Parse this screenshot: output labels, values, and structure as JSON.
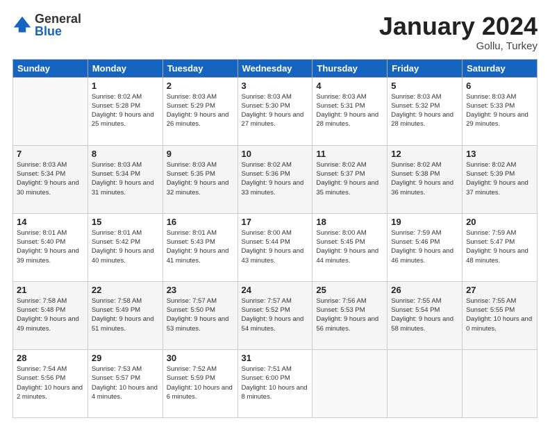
{
  "logo": {
    "general": "General",
    "blue": "Blue"
  },
  "header": {
    "title": "January 2024",
    "subtitle": "Gollu, Turkey"
  },
  "days_of_week": [
    "Sunday",
    "Monday",
    "Tuesday",
    "Wednesday",
    "Thursday",
    "Friday",
    "Saturday"
  ],
  "weeks": [
    [
      {
        "day": null
      },
      {
        "day": "1",
        "sunrise": "Sunrise: 8:02 AM",
        "sunset": "Sunset: 5:28 PM",
        "daylight": "Daylight: 9 hours and 25 minutes."
      },
      {
        "day": "2",
        "sunrise": "Sunrise: 8:03 AM",
        "sunset": "Sunset: 5:29 PM",
        "daylight": "Daylight: 9 hours and 26 minutes."
      },
      {
        "day": "3",
        "sunrise": "Sunrise: 8:03 AM",
        "sunset": "Sunset: 5:30 PM",
        "daylight": "Daylight: 9 hours and 27 minutes."
      },
      {
        "day": "4",
        "sunrise": "Sunrise: 8:03 AM",
        "sunset": "Sunset: 5:31 PM",
        "daylight": "Daylight: 9 hours and 28 minutes."
      },
      {
        "day": "5",
        "sunrise": "Sunrise: 8:03 AM",
        "sunset": "Sunset: 5:32 PM",
        "daylight": "Daylight: 9 hours and 28 minutes."
      },
      {
        "day": "6",
        "sunrise": "Sunrise: 8:03 AM",
        "sunset": "Sunset: 5:33 PM",
        "daylight": "Daylight: 9 hours and 29 minutes."
      }
    ],
    [
      {
        "day": "7",
        "sunrise": "Sunrise: 8:03 AM",
        "sunset": "Sunset: 5:34 PM",
        "daylight": "Daylight: 9 hours and 30 minutes."
      },
      {
        "day": "8",
        "sunrise": "Sunrise: 8:03 AM",
        "sunset": "Sunset: 5:34 PM",
        "daylight": "Daylight: 9 hours and 31 minutes."
      },
      {
        "day": "9",
        "sunrise": "Sunrise: 8:03 AM",
        "sunset": "Sunset: 5:35 PM",
        "daylight": "Daylight: 9 hours and 32 minutes."
      },
      {
        "day": "10",
        "sunrise": "Sunrise: 8:02 AM",
        "sunset": "Sunset: 5:36 PM",
        "daylight": "Daylight: 9 hours and 33 minutes."
      },
      {
        "day": "11",
        "sunrise": "Sunrise: 8:02 AM",
        "sunset": "Sunset: 5:37 PM",
        "daylight": "Daylight: 9 hours and 35 minutes."
      },
      {
        "day": "12",
        "sunrise": "Sunrise: 8:02 AM",
        "sunset": "Sunset: 5:38 PM",
        "daylight": "Daylight: 9 hours and 36 minutes."
      },
      {
        "day": "13",
        "sunrise": "Sunrise: 8:02 AM",
        "sunset": "Sunset: 5:39 PM",
        "daylight": "Daylight: 9 hours and 37 minutes."
      }
    ],
    [
      {
        "day": "14",
        "sunrise": "Sunrise: 8:01 AM",
        "sunset": "Sunset: 5:40 PM",
        "daylight": "Daylight: 9 hours and 39 minutes."
      },
      {
        "day": "15",
        "sunrise": "Sunrise: 8:01 AM",
        "sunset": "Sunset: 5:42 PM",
        "daylight": "Daylight: 9 hours and 40 minutes."
      },
      {
        "day": "16",
        "sunrise": "Sunrise: 8:01 AM",
        "sunset": "Sunset: 5:43 PM",
        "daylight": "Daylight: 9 hours and 41 minutes."
      },
      {
        "day": "17",
        "sunrise": "Sunrise: 8:00 AM",
        "sunset": "Sunset: 5:44 PM",
        "daylight": "Daylight: 9 hours and 43 minutes."
      },
      {
        "day": "18",
        "sunrise": "Sunrise: 8:00 AM",
        "sunset": "Sunset: 5:45 PM",
        "daylight": "Daylight: 9 hours and 44 minutes."
      },
      {
        "day": "19",
        "sunrise": "Sunrise: 7:59 AM",
        "sunset": "Sunset: 5:46 PM",
        "daylight": "Daylight: 9 hours and 46 minutes."
      },
      {
        "day": "20",
        "sunrise": "Sunrise: 7:59 AM",
        "sunset": "Sunset: 5:47 PM",
        "daylight": "Daylight: 9 hours and 48 minutes."
      }
    ],
    [
      {
        "day": "21",
        "sunrise": "Sunrise: 7:58 AM",
        "sunset": "Sunset: 5:48 PM",
        "daylight": "Daylight: 9 hours and 49 minutes."
      },
      {
        "day": "22",
        "sunrise": "Sunrise: 7:58 AM",
        "sunset": "Sunset: 5:49 PM",
        "daylight": "Daylight: 9 hours and 51 minutes."
      },
      {
        "day": "23",
        "sunrise": "Sunrise: 7:57 AM",
        "sunset": "Sunset: 5:50 PM",
        "daylight": "Daylight: 9 hours and 53 minutes."
      },
      {
        "day": "24",
        "sunrise": "Sunrise: 7:57 AM",
        "sunset": "Sunset: 5:52 PM",
        "daylight": "Daylight: 9 hours and 54 minutes."
      },
      {
        "day": "25",
        "sunrise": "Sunrise: 7:56 AM",
        "sunset": "Sunset: 5:53 PM",
        "daylight": "Daylight: 9 hours and 56 minutes."
      },
      {
        "day": "26",
        "sunrise": "Sunrise: 7:55 AM",
        "sunset": "Sunset: 5:54 PM",
        "daylight": "Daylight: 9 hours and 58 minutes."
      },
      {
        "day": "27",
        "sunrise": "Sunrise: 7:55 AM",
        "sunset": "Sunset: 5:55 PM",
        "daylight": "Daylight: 10 hours and 0 minutes."
      }
    ],
    [
      {
        "day": "28",
        "sunrise": "Sunrise: 7:54 AM",
        "sunset": "Sunset: 5:56 PM",
        "daylight": "Daylight: 10 hours and 2 minutes."
      },
      {
        "day": "29",
        "sunrise": "Sunrise: 7:53 AM",
        "sunset": "Sunset: 5:57 PM",
        "daylight": "Daylight: 10 hours and 4 minutes."
      },
      {
        "day": "30",
        "sunrise": "Sunrise: 7:52 AM",
        "sunset": "Sunset: 5:59 PM",
        "daylight": "Daylight: 10 hours and 6 minutes."
      },
      {
        "day": "31",
        "sunrise": "Sunrise: 7:51 AM",
        "sunset": "Sunset: 6:00 PM",
        "daylight": "Daylight: 10 hours and 8 minutes."
      },
      {
        "day": null
      },
      {
        "day": null
      },
      {
        "day": null
      }
    ]
  ]
}
